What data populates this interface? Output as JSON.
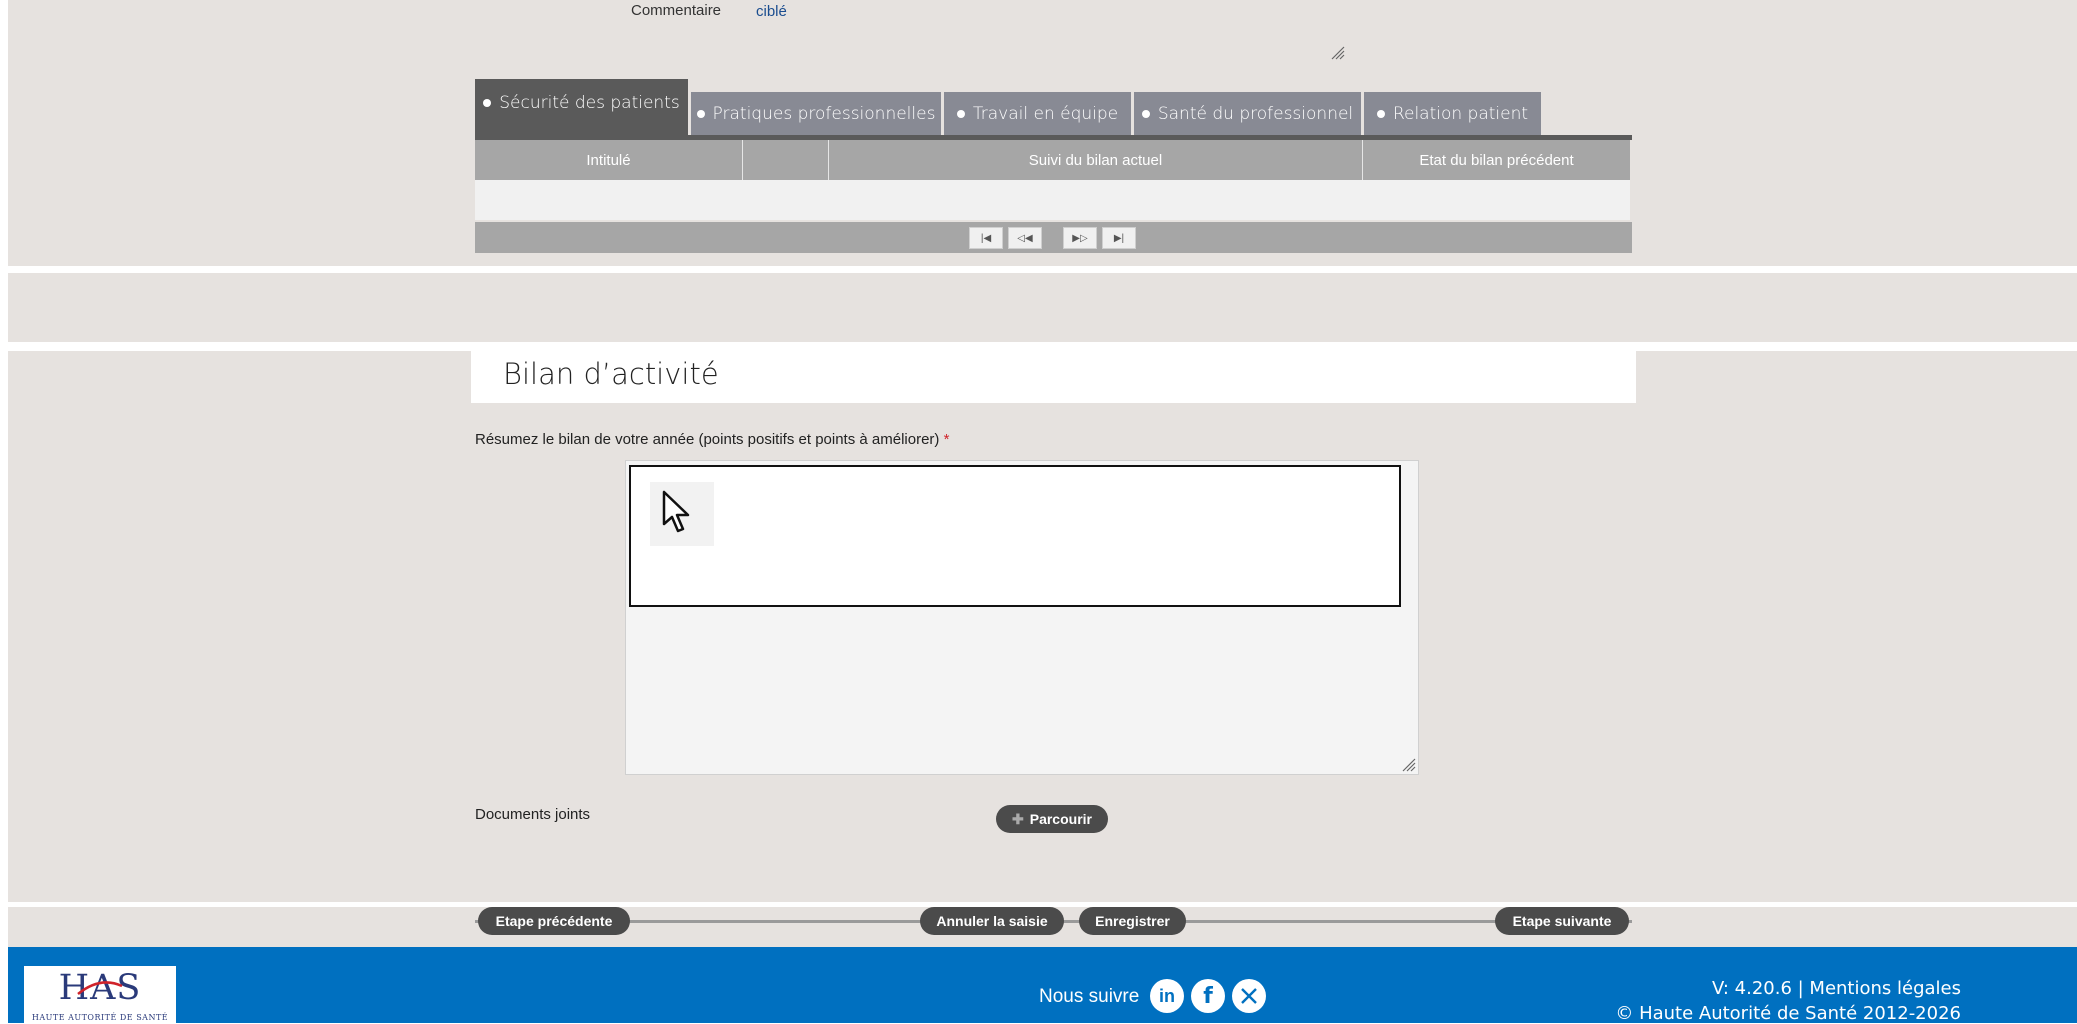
{
  "top_panel": {
    "comment_label": "Commentaire",
    "comment_value": "ciblé"
  },
  "tabs": [
    {
      "label": "Sécurité des patients",
      "active": true
    },
    {
      "label": "Pratiques professionnelles",
      "active": false
    },
    {
      "label": "Travail en équipe",
      "active": false
    },
    {
      "label": "Santé du professionnel",
      "active": false
    },
    {
      "label": "Relation patient",
      "active": false
    }
  ],
  "table": {
    "columns": [
      "Intitulé",
      "",
      "Suivi du bilan actuel",
      "Etat du bilan précédent"
    ],
    "pager": [
      "first-page-icon",
      "prev-page-icon",
      "next-page-icon",
      "last-page-icon"
    ]
  },
  "section": {
    "title": "Bilan d’activité",
    "question": "Résumez le bilan de votre année (points positifs et points à améliorer)",
    "required_mark": "*",
    "answer_value": "",
    "documents_label": "Documents joints",
    "browse_label": "Parcourir"
  },
  "nav": {
    "prev_label": "Etape précédente",
    "cancel_label": "Annuler la saisie",
    "save_label": "Enregistrer",
    "next_label": "Etape suivante"
  },
  "footer": {
    "logo_text": "HAS",
    "logo_subtitle": "HAUTE AUTORITÉ DE SANTÉ",
    "follow_label": "Nous suivre",
    "social": [
      "linkedin-icon",
      "facebook-icon",
      "x-icon"
    ],
    "version": "V: 4.20.6 | Mentions légales",
    "copyright": "© Haute Autorité de Santé 2012-2026"
  },
  "colors": {
    "panel_bg": "#e6e2df",
    "tab_active": "#5a5a5a",
    "tab_inactive": "#888a94",
    "button_bg": "#4b4b4b",
    "footer_bg": "#0070c0",
    "required": "#d0232a"
  }
}
